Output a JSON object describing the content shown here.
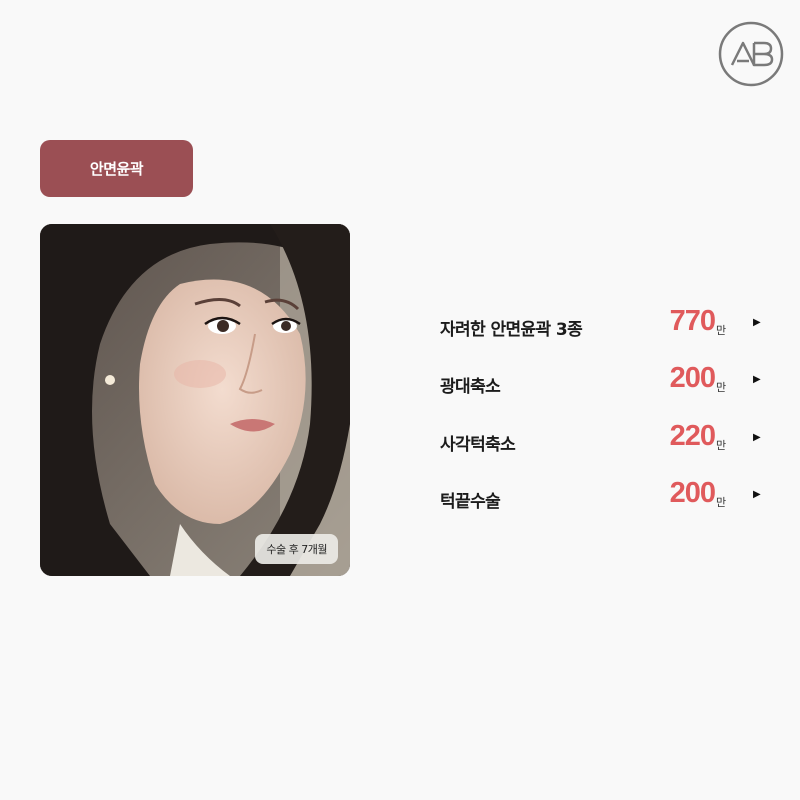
{
  "category": {
    "label": "안면윤곽"
  },
  "photo": {
    "badge": "수술 후 7개월"
  },
  "prices": [
    {
      "name": "자려한 안면윤곽 3종",
      "price": "770",
      "unit": "만"
    },
    {
      "name": "광대축소",
      "price": "200",
      "unit": "만"
    },
    {
      "name": "사각턱축소",
      "price": "220",
      "unit": "만"
    },
    {
      "name": "턱끝수술",
      "price": "200",
      "unit": "만"
    }
  ],
  "colors": {
    "accent": "#9b4f54",
    "price": "#e05a5c",
    "background": "#f9f9f9"
  },
  "icons": {
    "logo": "ab-logo-icon",
    "arrow": "play-arrow-icon"
  }
}
